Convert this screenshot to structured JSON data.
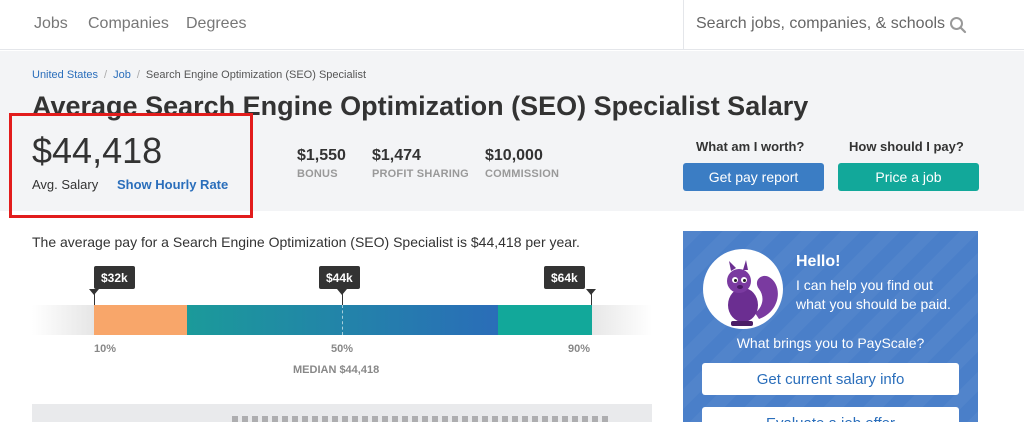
{
  "nav": {
    "links": [
      "Jobs",
      "Companies",
      "Degrees"
    ],
    "search_placeholder": "Search jobs, companies, & schools"
  },
  "breadcrumb": [
    "United States",
    "Job",
    "Search Engine Optimization (SEO) Specialist"
  ],
  "title": "Average Search Engine Optimization (SEO) Specialist Salary",
  "salary": {
    "amount": "$44,418",
    "label": "Avg. Salary",
    "hourly_link": "Show Hourly Rate"
  },
  "stats": [
    {
      "value": "$1,550",
      "label": "BONUS"
    },
    {
      "value": "$1,474",
      "label": "PROFIT SHARING"
    },
    {
      "value": "$10,000",
      "label": "COMMISSION"
    }
  ],
  "cta": [
    {
      "question": "What am I worth?",
      "button": "Get pay report"
    },
    {
      "question": "How should I pay?",
      "button": "Price a job"
    }
  ],
  "description": "The average pay for a Search Engine Optimization (SEO) Specialist is $44,418 per year.",
  "range": {
    "markers": [
      "$32k",
      "$44k",
      "$64k"
    ],
    "percentiles": [
      "10%",
      "50%",
      "90%"
    ],
    "median": "MEDIAN $44,418"
  },
  "chat": {
    "greeting": "Hello!",
    "message": "I can help you find out what you should be paid.",
    "question": "What brings you to PayScale?",
    "buttons": [
      "Get current salary info",
      "Evaluate a job offer"
    ]
  },
  "colors": {
    "link": "#2a6ebb",
    "highlight": "#e21c1c",
    "primary_button": "#3b7dc4",
    "secondary_button": "#12a89a",
    "low_range": "#f8a66a",
    "chat_panel": "#4a7fc9"
  }
}
